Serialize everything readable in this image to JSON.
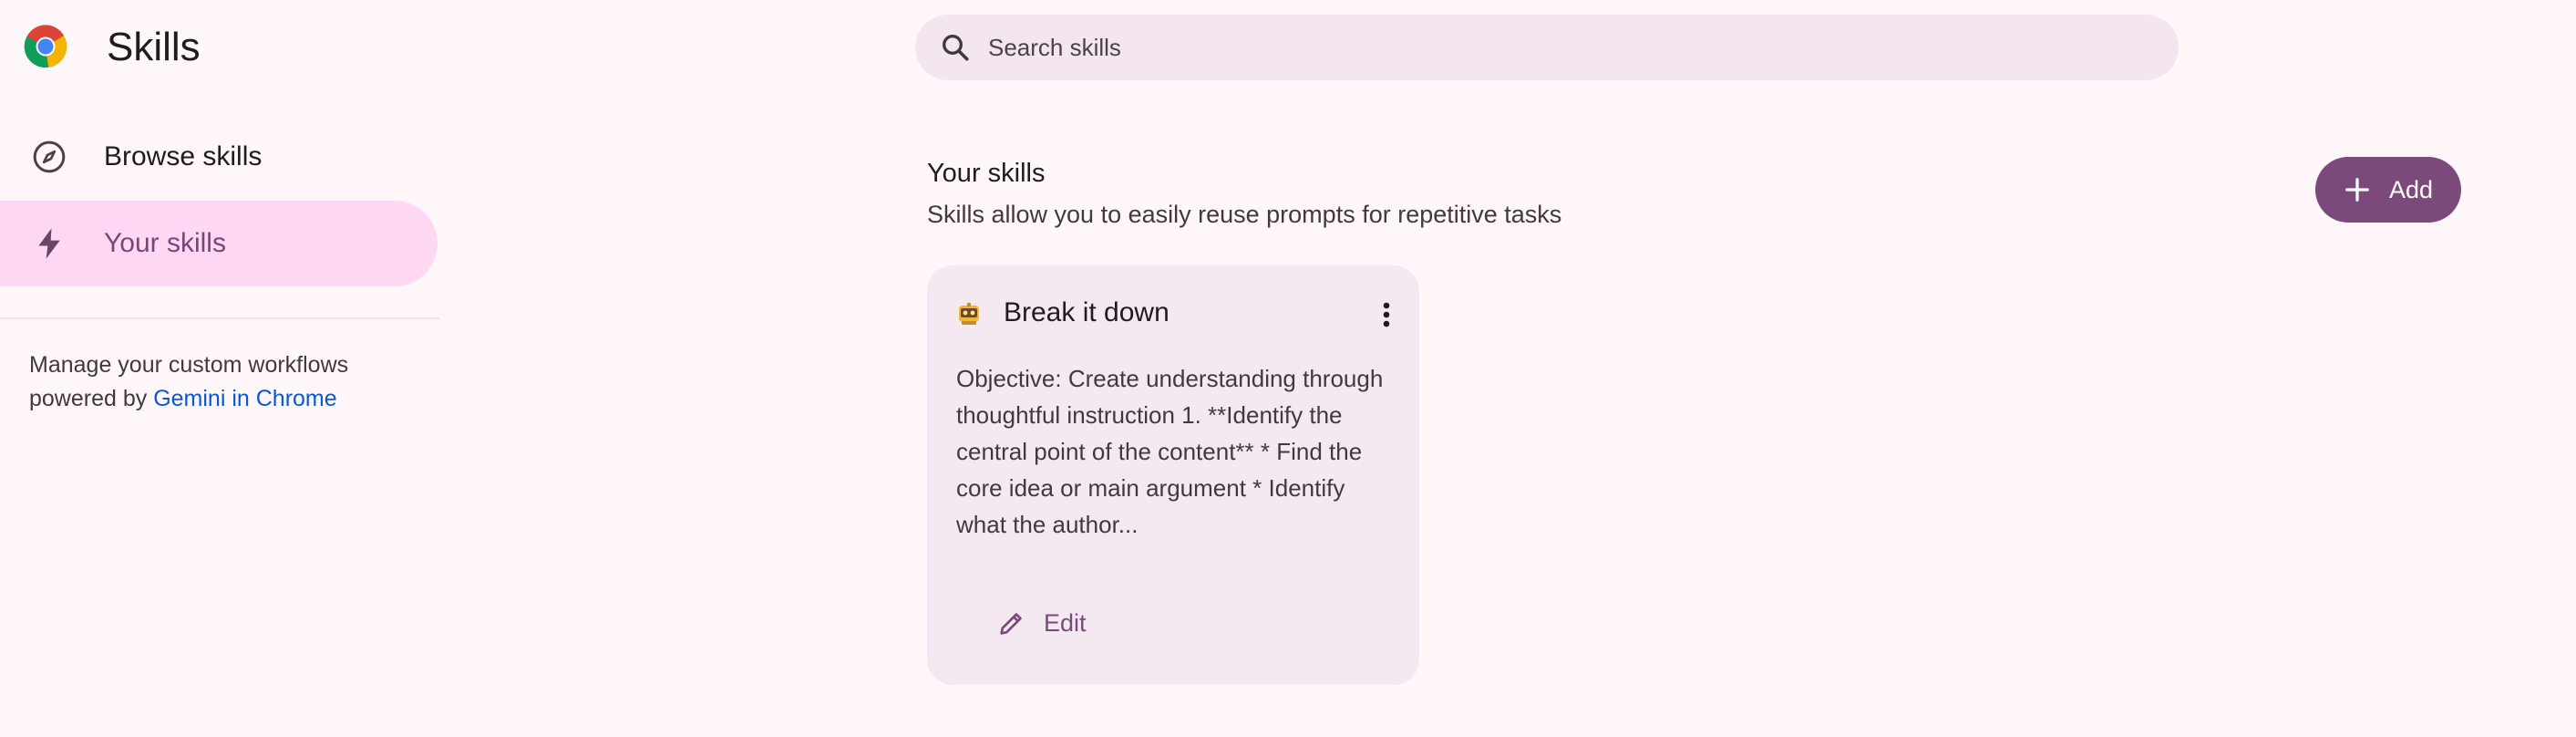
{
  "app": {
    "title": "Skills"
  },
  "search": {
    "placeholder": "Search skills",
    "value": ""
  },
  "sidebar": {
    "items": [
      {
        "label": "Browse skills",
        "icon": "compass-icon",
        "selected": false
      },
      {
        "label": "Your skills",
        "icon": "bolt-icon",
        "selected": true
      }
    ],
    "note_prefix": "Manage your custom workflows powered by ",
    "note_link": "Gemini in Chrome"
  },
  "main": {
    "section_title": "Your skills",
    "section_subtitle": "Skills allow you to easily reuse prompts for repetitive tasks",
    "add_label": "Add",
    "cards": [
      {
        "emoji": "robot-teacher-emoji",
        "title": "Break it down",
        "description": "Objective: Create understanding through thoughtful instruction 1. **Identify the central point of the content** * Find the core idea or main argument * Identify what the author...",
        "edit_label": "Edit"
      }
    ]
  },
  "colors": {
    "background": "#fff7fa",
    "accent": "#7c4a7a",
    "selected_nav": "#ffd9f4",
    "card": "#f4e9f1",
    "link": "#0b57d0"
  }
}
